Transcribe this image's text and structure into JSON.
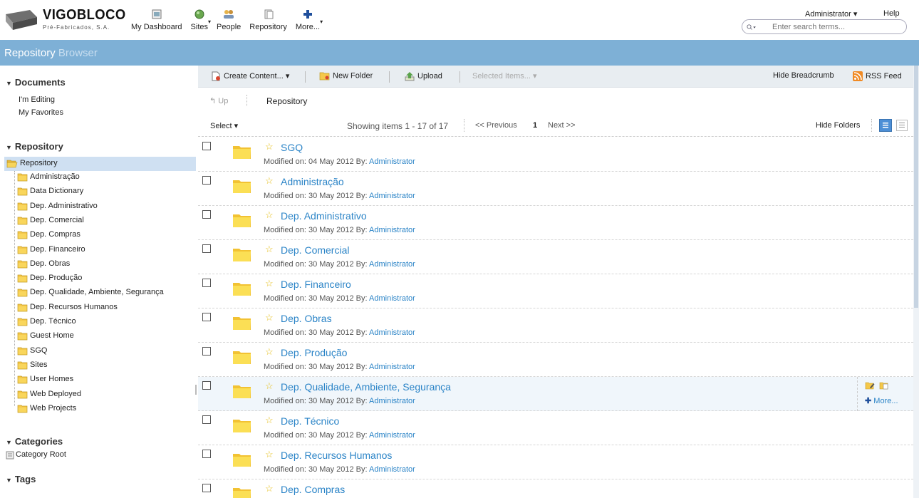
{
  "brand": {
    "name": "VIGOBLOCO",
    "tagline": "Pré-Fabricados, S.A."
  },
  "nav": {
    "items": [
      {
        "label": "My Dashboard",
        "icon": "dashboard-icon"
      },
      {
        "label": "Sites",
        "icon": "sites-icon"
      },
      {
        "label": "People",
        "icon": "people-icon"
      },
      {
        "label": "Repository",
        "icon": "repository-icon"
      },
      {
        "label": "More...",
        "icon": "plus-icon"
      }
    ]
  },
  "user": {
    "name": "Administrator ▾",
    "help": "Help"
  },
  "search": {
    "placeholder": "Enter search terms..."
  },
  "title": {
    "part1": "Repository",
    "part2": "Browser"
  },
  "sidebar": {
    "documents_heading": "Documents",
    "documents_links": [
      "I'm Editing",
      "My Favorites"
    ],
    "repository_heading": "Repository",
    "tree_root": "Repository",
    "tree_items": [
      "Administração",
      "Data Dictionary",
      "Dep. Administrativo",
      "Dep. Comercial",
      "Dep. Compras",
      "Dep. Financeiro",
      "Dep. Obras",
      "Dep. Produção",
      "Dep. Qualidade, Ambiente, Segurança",
      "Dep. Recursos Humanos",
      "Dep. Técnico",
      "Guest Home",
      "SGQ",
      "Sites",
      "User Homes",
      "Web Deployed",
      "Web Projects"
    ],
    "categories_heading": "Categories",
    "category_root": "Category Root",
    "tags_heading": "Tags"
  },
  "toolbar": {
    "create_content": "Create Content... ▾",
    "new_folder": "New Folder",
    "upload": "Upload",
    "selected_items": "Selected Items... ▾",
    "hide_breadcrumb": "Hide Breadcrumb",
    "rss_feed": "RSS Feed"
  },
  "breadcrumb": {
    "up": "Up",
    "current": "Repository"
  },
  "list": {
    "select": "Select ▾",
    "showing": "Showing items 1 - 17 of 17",
    "previous": "<< Previous",
    "page": "1",
    "next": "Next >>",
    "hide_folders": "Hide Folders",
    "modified_prefix": "Modified on:",
    "by_prefix": "By:",
    "more_action": "More...",
    "rows": [
      {
        "title": "SGQ",
        "date": "04 May 2012",
        "by": "Administrator"
      },
      {
        "title": "Administração",
        "date": "30 May 2012",
        "by": "Administrator"
      },
      {
        "title": "Dep. Administrativo",
        "date": "30 May 2012",
        "by": "Administrator"
      },
      {
        "title": "Dep. Comercial",
        "date": "30 May 2012",
        "by": "Administrator"
      },
      {
        "title": "Dep. Financeiro",
        "date": "30 May 2012",
        "by": "Administrator"
      },
      {
        "title": "Dep. Obras",
        "date": "30 May 2012",
        "by": "Administrator"
      },
      {
        "title": "Dep. Produção",
        "date": "30 May 2012",
        "by": "Administrator"
      },
      {
        "title": "Dep. Qualidade, Ambiente, Segurança",
        "date": "30 May 2012",
        "by": "Administrator",
        "highlighted": true
      },
      {
        "title": "Dep. Técnico",
        "date": "30 May 2012",
        "by": "Administrator"
      },
      {
        "title": "Dep. Recursos Humanos",
        "date": "30 May 2012",
        "by": "Administrator"
      },
      {
        "title": "Dep. Compras",
        "date": "",
        "by": ""
      }
    ]
  },
  "colors": {
    "titlebar": "#7eb0d6",
    "link": "#2b84c7",
    "folder": "#f5d33a",
    "selected_tree": "#cfe0f2"
  }
}
